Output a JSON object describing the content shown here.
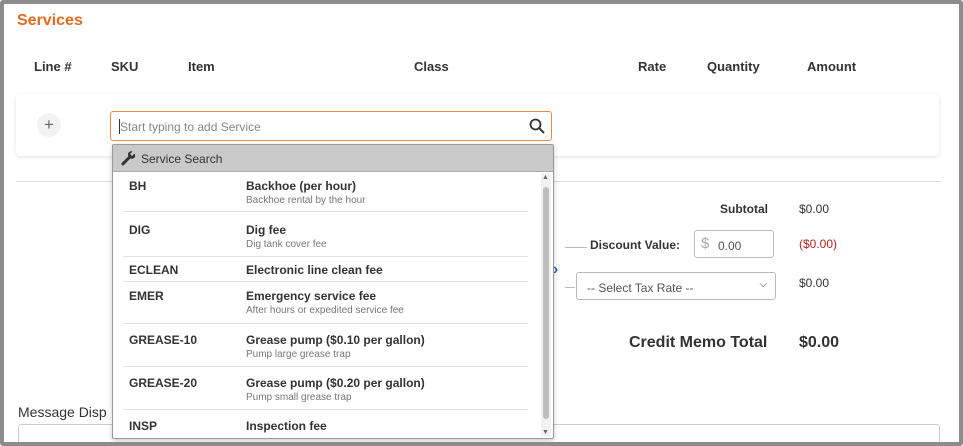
{
  "section": {
    "title": "Services"
  },
  "columns": [
    "Line #",
    "SKU",
    "Item",
    "Class",
    "Rate",
    "Quantity",
    "Amount"
  ],
  "search": {
    "placeholder": "Start typing to add Service"
  },
  "dropdown": {
    "header": "Service Search",
    "items": [
      {
        "sku": "BH",
        "name": "Backhoe (per hour)",
        "desc": "Backhoe rental by the hour"
      },
      {
        "sku": "DIG",
        "name": "Dig fee",
        "desc": "Dig tank cover fee"
      },
      {
        "sku": "ECLEAN",
        "name": "Electronic line clean fee",
        "desc": ""
      },
      {
        "sku": "EMER",
        "name": "Emergency service fee",
        "desc": "After hours or expedited service fee"
      },
      {
        "sku": "GREASE-10",
        "name": "Grease pump ($0.10 per gallon)",
        "desc": "Pump large grease trap"
      },
      {
        "sku": "GREASE-20",
        "name": "Grease pump ($0.20 per gallon)",
        "desc": "Pump small grease trap"
      },
      {
        "sku": "INSP",
        "name": "Inspection fee",
        "desc": ""
      }
    ]
  },
  "totals": {
    "subtotal_label": "Subtotal",
    "subtotal_value": "$0.00",
    "discount_label": "Discount Value:",
    "discount_currency": "$",
    "discount_input": "0.00",
    "discount_value": "($0.00)",
    "tax_select": "-- Select Tax Rate --",
    "tax_value": "$0.00",
    "total_label": "Credit Memo Total",
    "total_value": "$0.00"
  },
  "message": {
    "label": "Message Disp"
  },
  "colors": {
    "accent": "#e26b1f",
    "negative": "#b22222"
  },
  "icons": {
    "add": "plus-icon",
    "search": "search-icon",
    "wrench": "wrench-icon",
    "select": "chevron-down-icon"
  }
}
